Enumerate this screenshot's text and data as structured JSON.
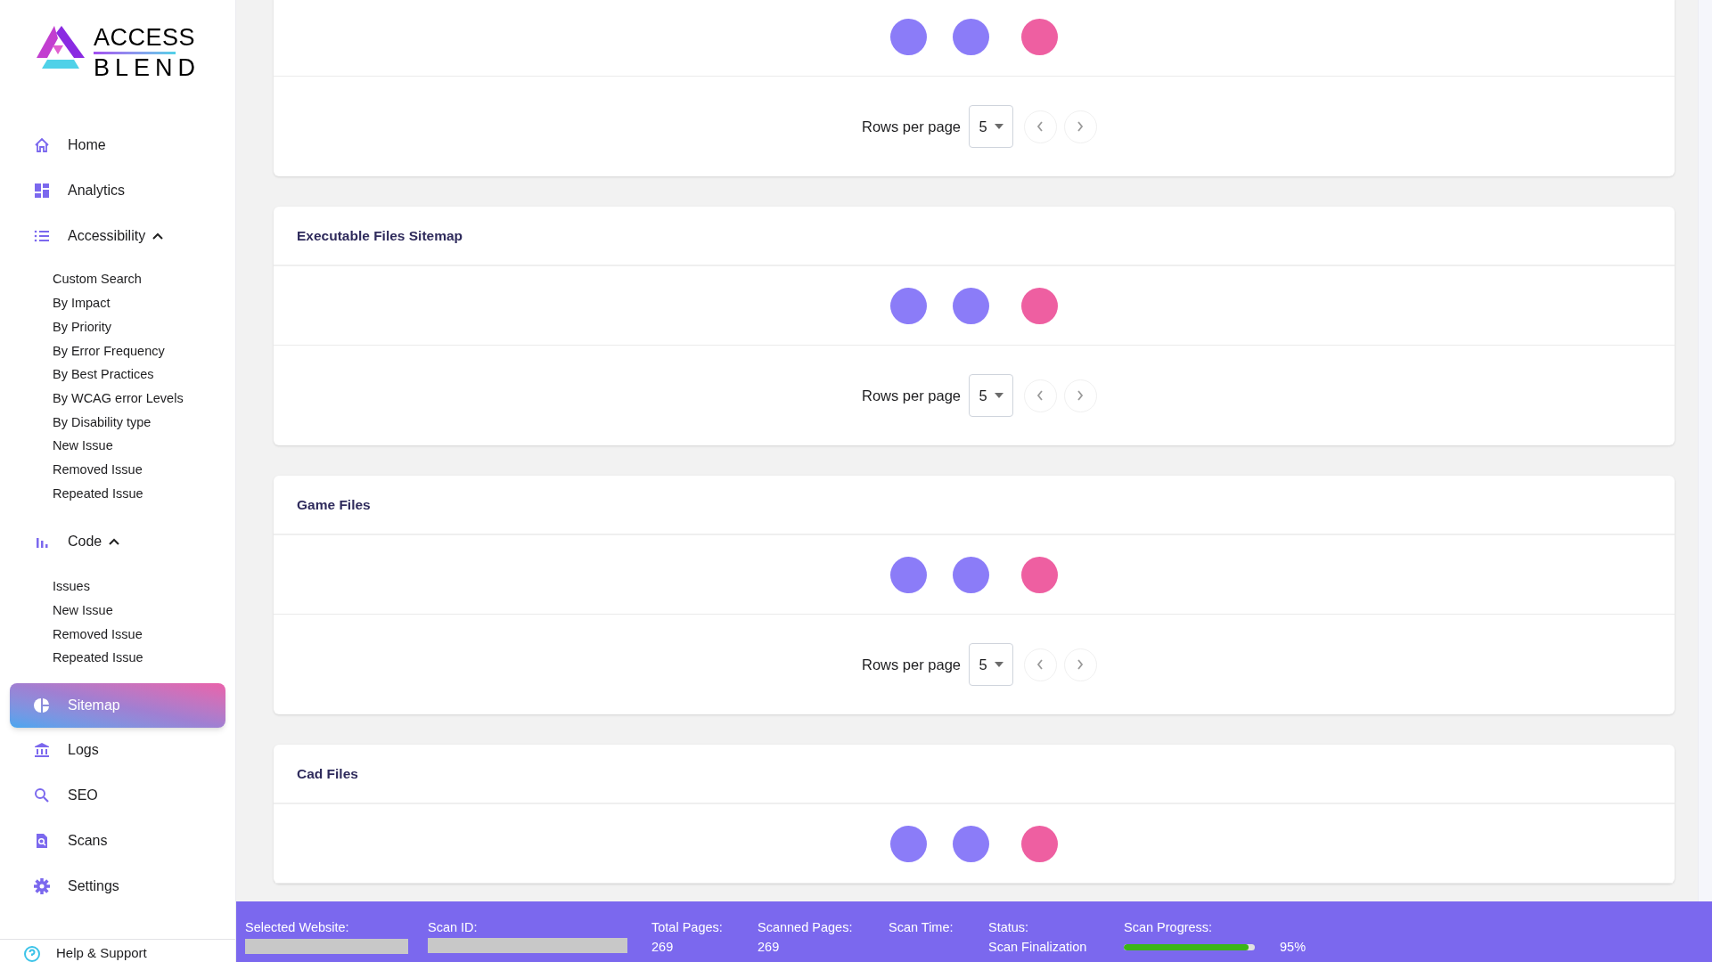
{
  "logo": {
    "line_1": "ACCESS",
    "line_2": "BLEND"
  },
  "sidebar": {
    "items": [
      {
        "label": "Home",
        "selected": false
      },
      {
        "label": "Analytics",
        "selected": false
      },
      {
        "label": "Accessibility",
        "selected": false,
        "expanded": true,
        "children": [
          {
            "label": "Custom Search"
          },
          {
            "label": "By Impact"
          },
          {
            "label": "By Priority"
          },
          {
            "label": "By Error Frequency"
          },
          {
            "label": "By Best Practices"
          },
          {
            "label": "By WCAG error Levels"
          },
          {
            "label": "By Disability type"
          },
          {
            "label": "New Issue"
          },
          {
            "label": "Removed Issue"
          },
          {
            "label": "Repeated Issue"
          }
        ]
      },
      {
        "label": "Code",
        "selected": false,
        "expanded": true,
        "children": [
          {
            "label": "Issues"
          },
          {
            "label": "New Issue"
          },
          {
            "label": "Removed Issue"
          },
          {
            "label": "Repeated Issue"
          }
        ]
      },
      {
        "label": "Sitemap",
        "selected": true
      },
      {
        "label": "Logs",
        "selected": false
      },
      {
        "label": "SEO",
        "selected": false
      },
      {
        "label": "Scans",
        "selected": false
      },
      {
        "label": "Settings",
        "selected": false
      }
    ],
    "footer_link": "Help & Support"
  },
  "cards": [
    {
      "dots": [
        {
          "color": "#8b7cf8"
        },
        {
          "color": "#8b7cf8"
        },
        {
          "color": "#ee5fa1"
        }
      ],
      "pagination": {
        "label": "Rows per page",
        "rows_value": "5"
      }
    },
    {
      "title": "Executable Files Sitemap",
      "dots": [
        {
          "color": "#8b7cf8"
        },
        {
          "color": "#8b7cf8"
        },
        {
          "color": "#ee5fa1"
        }
      ],
      "pagination": {
        "label": "Rows per page",
        "rows_value": "5"
      }
    },
    {
      "title": "Game Files",
      "dots": [
        {
          "color": "#8b7cf8"
        },
        {
          "color": "#8b7cf8"
        },
        {
          "color": "#ee5fa1"
        }
      ],
      "pagination": {
        "label": "Rows per page",
        "rows_value": "5"
      }
    },
    {
      "title": "Cad Files",
      "dots": [
        {
          "color": "#8b7cf8"
        },
        {
          "color": "#8b7cf8"
        },
        {
          "color": "#ee5fa1"
        }
      ]
    }
  ],
  "status_bar": {
    "fields": [
      {
        "label": "Selected Website:",
        "kind": "redacted"
      },
      {
        "label": "Scan ID:",
        "kind": "redacted"
      },
      {
        "label": "Total Pages:",
        "kind": "text",
        "value": "269"
      },
      {
        "label": "Scanned Pages:",
        "kind": "text",
        "value": "269"
      },
      {
        "label": "Scan Time:",
        "kind": "text"
      },
      {
        "label": "Status:",
        "kind": "text",
        "value": "Scan Finalization"
      },
      {
        "label": "Scan Progress:",
        "kind": "progress",
        "level": 0.95,
        "reading": "95%"
      }
    ]
  }
}
